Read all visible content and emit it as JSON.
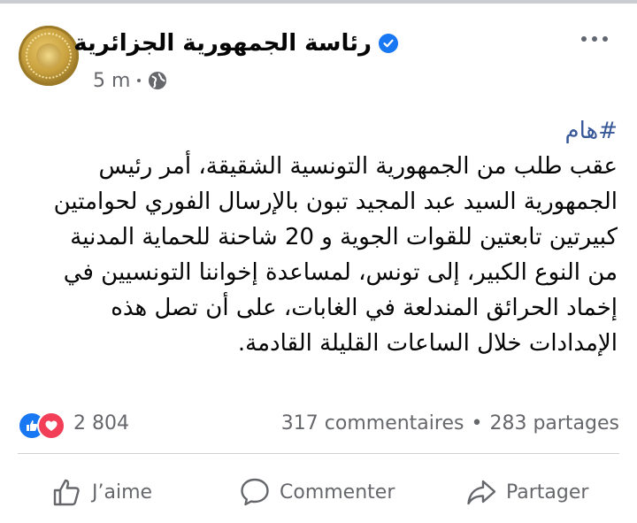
{
  "header": {
    "page_name": "رئاسة الجمهورية الجزائرية",
    "time": "5 m",
    "privacy_icon": "globe-icon",
    "verified_icon": "verified-badge-icon",
    "more_icon": "more-options-icon"
  },
  "post": {
    "hashtag": "#هام",
    "body": "عقب طلب من الجمهورية التونسية الشقيقة، أمر رئيس\nالجمهورية السيد عبد المجيد تبون بالإرسال الفوري لحوامتين\nكبيرتين تابعتين للقوات الجوية و 20 شاحنة للحماية المدنية\nمن النوع الكبير، إلى تونس، لمساعدة إخواننا التونسيين في\nإخماد الحرائق المندلعة في الغابات، على أن تصل هذه\nالإمدادات خلال الساعات القليلة القادمة."
  },
  "reactions": {
    "count": "2 804",
    "icons": [
      "like-reaction-icon",
      "love-reaction-icon"
    ]
  },
  "engagement": {
    "comments": "317 commentaires",
    "separator": "•",
    "shares": "283 partages"
  },
  "actions": {
    "like": "J’aime",
    "comment": "Commenter",
    "share": "Partager"
  },
  "colors": {
    "accent": "#1877f2",
    "love": "#f33e58",
    "hashtag": "#385898",
    "muted_text": "#65676b"
  }
}
